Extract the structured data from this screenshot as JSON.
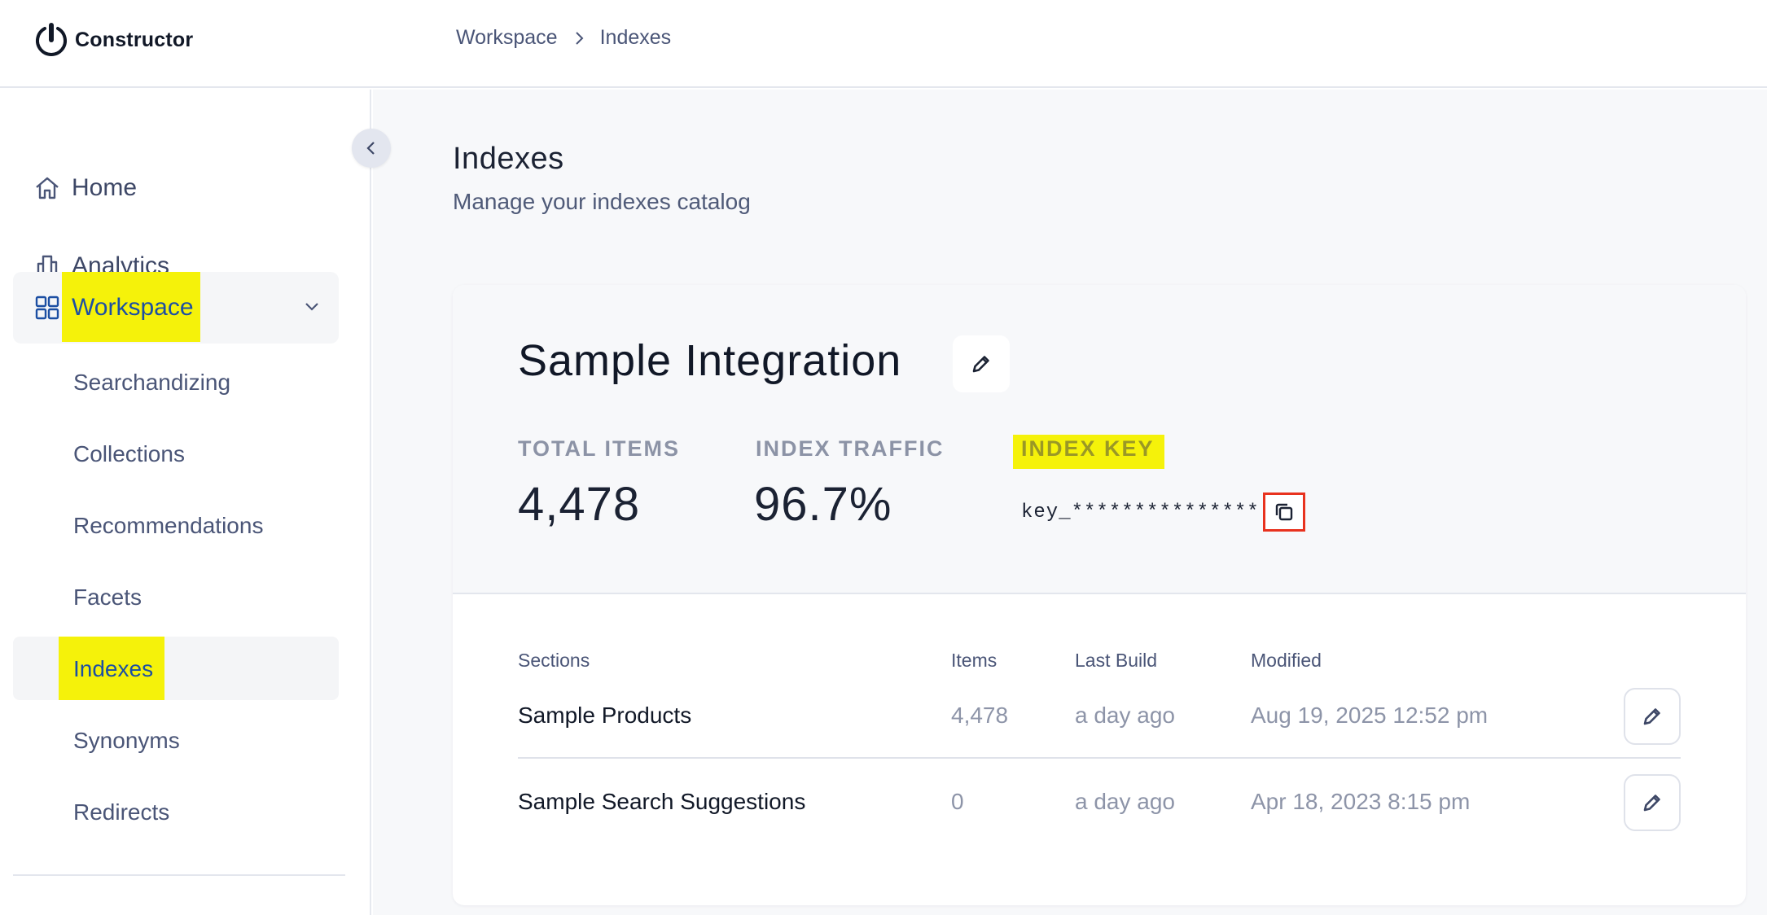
{
  "brand": {
    "name": "Constructor"
  },
  "breadcrumb": {
    "items": [
      "Workspace",
      "Indexes"
    ]
  },
  "sidebar": {
    "home": "Home",
    "analytics": "Analytics",
    "workspace": "Workspace",
    "sub_items": [
      "Searchandizing",
      "Collections",
      "Recommendations",
      "Facets",
      "Indexes",
      "Synonyms",
      "Redirects"
    ]
  },
  "page": {
    "title": "Indexes",
    "subtitle": "Manage your indexes catalog"
  },
  "integration": {
    "name": "Sample Integration",
    "total_items_label": "TOTAL ITEMS",
    "total_items_value": "4,478",
    "index_traffic_label": "INDEX TRAFFIC",
    "index_traffic_value": "96.7%",
    "index_key_label": "INDEX KEY",
    "index_key_value": "key_***************"
  },
  "table": {
    "headers": [
      "Sections",
      "Items",
      "Last Build",
      "Modified"
    ],
    "rows": [
      {
        "section": "Sample Products",
        "items": "4,478",
        "last_build": "a day ago",
        "modified": "Aug 19, 2025 12:52 pm"
      },
      {
        "section": "Sample Search Suggestions",
        "items": "0",
        "last_build": "a day ago",
        "modified": "Apr 18, 2023 8:15 pm"
      }
    ]
  },
  "colors": {
    "highlight": "#f5f20a",
    "focus_outline": "#e8321e",
    "active_nav_text": "#1c4fa3"
  },
  "icons": [
    "constructor-logo-icon",
    "chevron-right-icon",
    "home-icon",
    "analytics-icon",
    "workspace-grid-icon",
    "chevron-down-icon",
    "chevron-left-icon",
    "pencil-icon",
    "copy-icon"
  ]
}
